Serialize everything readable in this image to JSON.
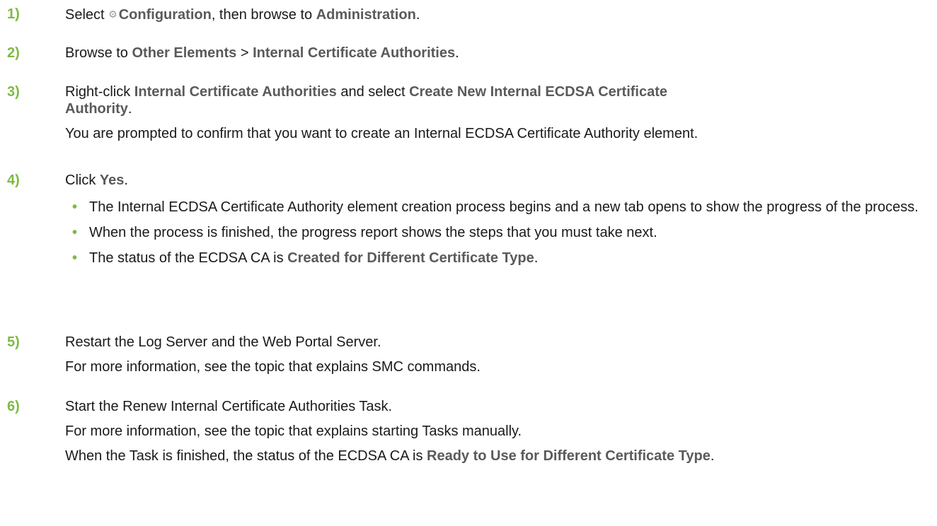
{
  "icons": {
    "configuration": "gear-icon"
  },
  "colors": {
    "step_number": "#7dbb42",
    "ui_term": "#5a5a5a",
    "text": "#1a1a1a"
  },
  "steps": [
    {
      "number": "1)",
      "t1": "Select ",
      "u1": "Configuration",
      "t2": ", then browse to ",
      "u2": "Administration",
      "t3": "."
    },
    {
      "number": "2)",
      "t1": "Browse to ",
      "u1": "Other Elements",
      "t2": " > ",
      "u2": "Internal Certificate Authorities",
      "t3": "."
    },
    {
      "number": "3)",
      "t1": "Right-click ",
      "u1": "Internal Certificate Authorities",
      "t2": " and select ",
      "u2": "Create New Internal ECDSA Certificate Authority",
      "t3": ".",
      "note": "You are prompted to confirm that you want to create an Internal ECDSA Certificate Authority element."
    },
    {
      "number": "4)",
      "t1": "Click ",
      "u1": "Yes",
      "t2": ".",
      "bullets": [
        {
          "text": "The Internal ECDSA Certificate Authority element creation process begins and a new tab opens to show the progress of the process."
        },
        {
          "text": "When the process is finished, the progress report shows the steps that you must take next."
        },
        {
          "t1": "The status of the ECDSA CA is ",
          "u1": "Created for Different Certificate Type",
          "t2": "."
        }
      ]
    },
    {
      "number": "5)",
      "text": "Restart the Log Server and the Web Portal Server.",
      "note": "For more information, see the topic that explains SMC commands."
    },
    {
      "number": "6)",
      "text": "Start the Renew Internal Certificate Authorities Task.",
      "note": "For more information, see the topic that explains starting Tasks manually.",
      "n2": "When the Task is finished, the status of the ECDSA CA is ",
      "u1": "Ready to Use for Different Certificate Type",
      "n3": "."
    }
  ]
}
